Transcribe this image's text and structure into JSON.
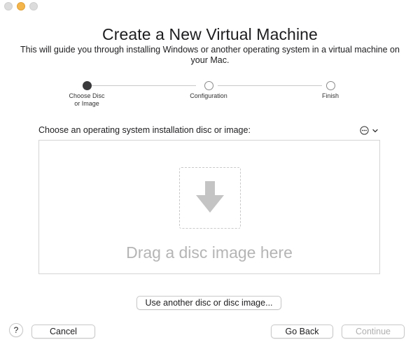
{
  "window": {
    "title": "Create a New Virtual Machine",
    "subtitle": "This will guide you through installing Windows or another operating system in a virtual machine on your Mac."
  },
  "stepper": {
    "current_step": 1,
    "steps": [
      {
        "label": "Choose Disc\nor Image",
        "state": "active"
      },
      {
        "label": "Configuration",
        "state": "pending"
      },
      {
        "label": "Finish",
        "state": "pending"
      }
    ]
  },
  "disc_selection": {
    "prompt": "Choose an operating system installation disc or image:",
    "options_icon": "ellipsis-circle-icon",
    "chevron_icon": "chevron-down-icon",
    "dropzone_text": "Drag a disc image here",
    "dropzone_icon": "arrow-down-icon",
    "another_disc_label": "Use another disc or disc image..."
  },
  "footer": {
    "help_label": "?",
    "cancel_label": "Cancel",
    "back_label": "Go Back",
    "continue_label": "Continue",
    "continue_enabled": false
  },
  "colors": {
    "accent_dot": "#3a3a3c",
    "minimize_light": "#f4b54a",
    "dropzone_text": "#b5b5b5",
    "disabled_text": "#b0b0b0"
  }
}
